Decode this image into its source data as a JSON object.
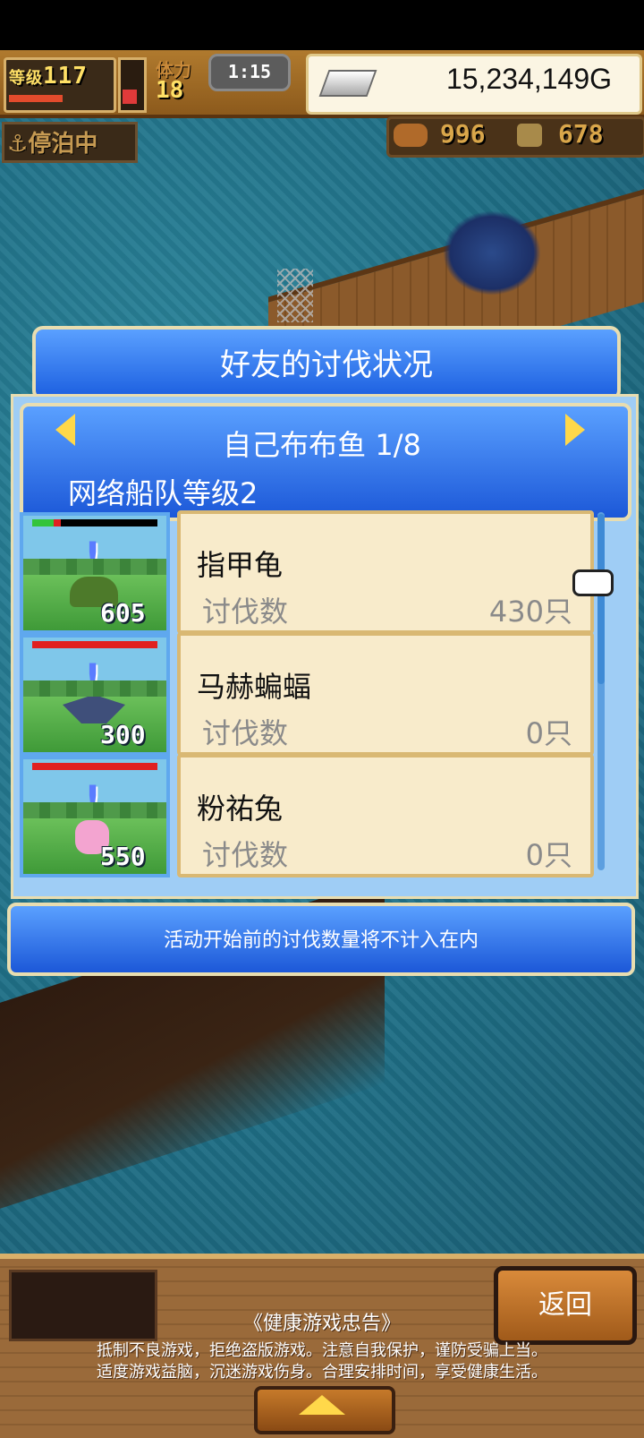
{
  "hud": {
    "level_label": "等级",
    "level_value": "117",
    "stamina_label": "体力",
    "stamina_value": "18",
    "timer": "1:15",
    "gold": "15,234,149G",
    "dock_status": "停泊中",
    "resource_1": "996",
    "resource_2": "678"
  },
  "dialog": {
    "title": "好友的讨伐状况",
    "friend_name": "自己布布鱼 1/8",
    "fleet_level": "网络船队等级2",
    "rows": [
      {
        "name": "指甲龟",
        "kill_label": "讨伐数",
        "kill_value": "430只",
        "hp_level": "605",
        "hp_color": "#33c43a"
      },
      {
        "name": "马赫蝙蝠",
        "kill_label": "讨伐数",
        "kill_value": "0只",
        "hp_level": "300",
        "hp_color": "#e02020"
      },
      {
        "name": "粉祐兔",
        "kill_label": "讨伐数",
        "kill_value": "0只",
        "hp_level": "550",
        "hp_color": "#e02020"
      }
    ],
    "note": "活动开始前的讨伐数量将不计入在内"
  },
  "bottom": {
    "back_label": "返回",
    "health_title": "《健康游戏忠告》",
    "health_line1": "抵制不良游戏，拒绝盗版游戏。注意自我保护，谨防受骗上当。",
    "health_line2": "适度游戏益脑，沉迷游戏伤身。合理安排时间，享受健康生活。"
  },
  "icons": {
    "gold": "silver-ingot-icon",
    "anchor": "anchor-icon",
    "resource_1": "fish-icon",
    "resource_2": "coin-icon",
    "prev": "arrow-left-icon",
    "next": "arrow-right-icon",
    "pointer": "hand-pointer-icon",
    "expand": "triangle-up-icon"
  }
}
